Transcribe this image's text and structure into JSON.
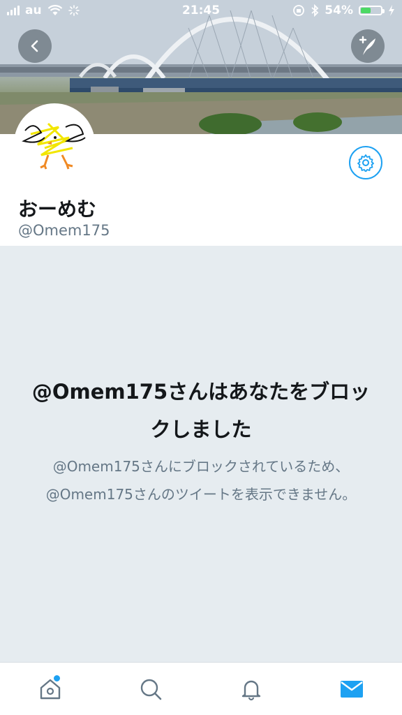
{
  "status_bar": {
    "carrier": "au",
    "time": "21:45",
    "battery_percent_label": "54%",
    "battery_level": 0.54
  },
  "header": {
    "back_icon": "chevron-left-icon",
    "compose_icon": "compose-tweet-icon"
  },
  "profile": {
    "display_name": "おーめむ",
    "handle": "@Omem175",
    "settings_icon": "gear-icon"
  },
  "blocked": {
    "title": "@Omem175さんはあなたをブロックしました",
    "description": "@Omem175さんにブロックされているため、@Omem175さんのツイートを表示できません。"
  },
  "tab_bar": {
    "items": [
      {
        "name": "home",
        "icon": "home-icon",
        "has_badge": true
      },
      {
        "name": "search",
        "icon": "search-icon",
        "has_badge": false
      },
      {
        "name": "notifications",
        "icon": "bell-icon",
        "has_badge": false
      },
      {
        "name": "messages",
        "icon": "envelope-icon",
        "has_badge": false
      }
    ],
    "accent_color": "#1da1f2",
    "inactive_color": "#657786"
  }
}
